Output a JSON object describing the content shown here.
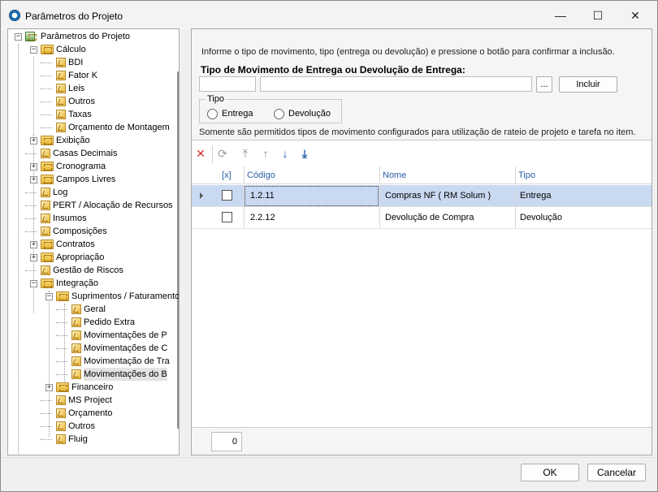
{
  "window": {
    "title": "Parâmetros do Projeto",
    "minimize_glyph": "—",
    "maximize_glyph": "☐",
    "close_glyph": "✕"
  },
  "tree": {
    "items": [
      {
        "label": "Parâmetros do Projeto",
        "icon": "root-icon",
        "expander": "−"
      },
      {
        "label": "Cálculo",
        "icon": "folder-icon",
        "expander": "−"
      },
      {
        "label": "BDI",
        "icon": "doc-icon"
      },
      {
        "label": "Fator K",
        "icon": "doc-icon"
      },
      {
        "label": "Leis",
        "icon": "doc-icon"
      },
      {
        "label": "Outros",
        "icon": "doc-icon"
      },
      {
        "label": "Taxas",
        "icon": "doc-icon"
      },
      {
        "label": "Orçamento de Montagem",
        "icon": "doc-icon"
      },
      {
        "label": "Exibição",
        "icon": "folder-icon",
        "expander": "+"
      },
      {
        "label": "Casas Decimais",
        "icon": "doc-icon"
      },
      {
        "label": "Cronograma",
        "icon": "folder-icon",
        "expander": "+"
      },
      {
        "label": "Campos Livres",
        "icon": "folder-icon",
        "expander": "+"
      },
      {
        "label": "Log",
        "icon": "doc-icon"
      },
      {
        "label": "PERT / Alocação de Recursos",
        "icon": "doc-icon"
      },
      {
        "label": "Insumos",
        "icon": "doc-icon"
      },
      {
        "label": "Composições",
        "icon": "doc-icon"
      },
      {
        "label": "Contratos",
        "icon": "folder-icon",
        "expander": "+"
      },
      {
        "label": "Apropriação",
        "icon": "folder-icon",
        "expander": "+"
      },
      {
        "label": "Gestão de Riscos",
        "icon": "doc-icon"
      },
      {
        "label": "Integração",
        "icon": "folder-icon",
        "expander": "−"
      },
      {
        "label": "Suprimentos / Faturamento",
        "icon": "folder-icon",
        "expander": "−"
      },
      {
        "label": "Geral",
        "icon": "doc-icon"
      },
      {
        "label": "Pedido Extra",
        "icon": "doc-icon"
      },
      {
        "label": "Movimentações de P",
        "icon": "doc-icon"
      },
      {
        "label": "Movimentações de C",
        "icon": "doc-icon"
      },
      {
        "label": "Movimentação de Tra",
        "icon": "doc-icon"
      },
      {
        "label": "Movimentações do B",
        "icon": "doc-icon",
        "selected": true
      },
      {
        "label": "Financeiro",
        "icon": "folder-icon",
        "expander": "+"
      },
      {
        "label": "MS Project",
        "icon": "doc-icon"
      },
      {
        "label": "Orçamento",
        "icon": "doc-icon"
      },
      {
        "label": "Outros",
        "icon": "doc-icon"
      },
      {
        "label": "Fluig",
        "icon": "doc-icon"
      }
    ]
  },
  "form": {
    "info": "Informe o tipo de movimento, tipo (entrega ou devolução) e pressione o botão para confirmar a inclusão.",
    "section_title": "Tipo de Movimento de Entrega ou Devolução de Entrega:",
    "code_value": "",
    "name_value": "",
    "browse_label": "...",
    "add_label": "Incluir",
    "type_group_label": "Tipo",
    "radio_delivery": "Entrega",
    "radio_return": "Devolução",
    "note": "Somente são permitidos tipos de movimento configurados para utilização de rateio de projeto e tarefa no item."
  },
  "toolbar": {
    "delete_icon": "✕",
    "refresh_icon": "⟳",
    "move_top_icon": "⤒",
    "move_up_icon": "↑",
    "move_down_icon": "↓",
    "move_bottom_icon": "⤓"
  },
  "grid": {
    "headers": {
      "check": "[x]",
      "code": "Código",
      "name": "Nome",
      "type": "Tipo"
    },
    "rows": [
      {
        "code": "1.2.11",
        "name": "Compras NF  ( RM Solum )",
        "type": "Entrega",
        "checked": false,
        "selected": true
      },
      {
        "code": "2.2.12",
        "name": "Devolução de Compra",
        "type": "Devolução",
        "checked": false,
        "selected": false
      }
    ],
    "count": "0"
  },
  "dialog": {
    "ok_label": "OK",
    "cancel_label": "Cancelar"
  },
  "colors": {
    "accent": "#2a5fa8",
    "selected_row": "#c9d9f2",
    "delete": "#d32f2f",
    "arrow": "#1f5fa8"
  }
}
